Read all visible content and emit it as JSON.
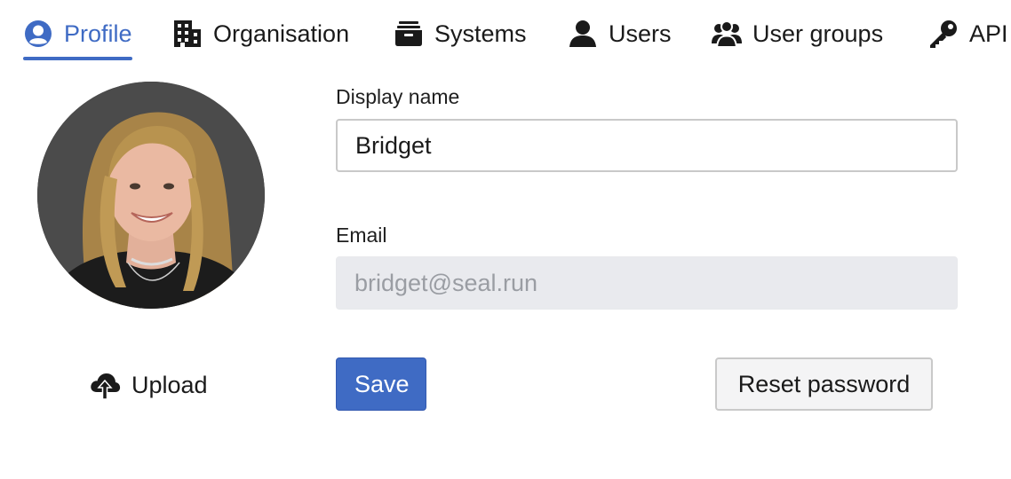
{
  "tabs": [
    {
      "label": "Profile",
      "icon": "user-circle-icon",
      "active": true
    },
    {
      "label": "Organisation",
      "icon": "building-icon",
      "active": false
    },
    {
      "label": "Systems",
      "icon": "archive-box-icon",
      "active": false
    },
    {
      "label": "Users",
      "icon": "user-icon",
      "active": false
    },
    {
      "label": "User groups",
      "icon": "users-icon",
      "active": false
    },
    {
      "label": "API",
      "icon": "key-icon",
      "active": false
    }
  ],
  "colors": {
    "accent": "#3f6bc4",
    "disabled_bg": "#e9eaee"
  },
  "profile": {
    "avatar_icon": "profile-photo",
    "upload_label": "Upload",
    "upload_icon": "cloud-upload-icon"
  },
  "form": {
    "display_name_label": "Display name",
    "display_name_value": "Bridget",
    "email_label": "Email",
    "email_value": "bridget@seal.run",
    "save_label": "Save",
    "reset_password_label": "Reset password"
  }
}
